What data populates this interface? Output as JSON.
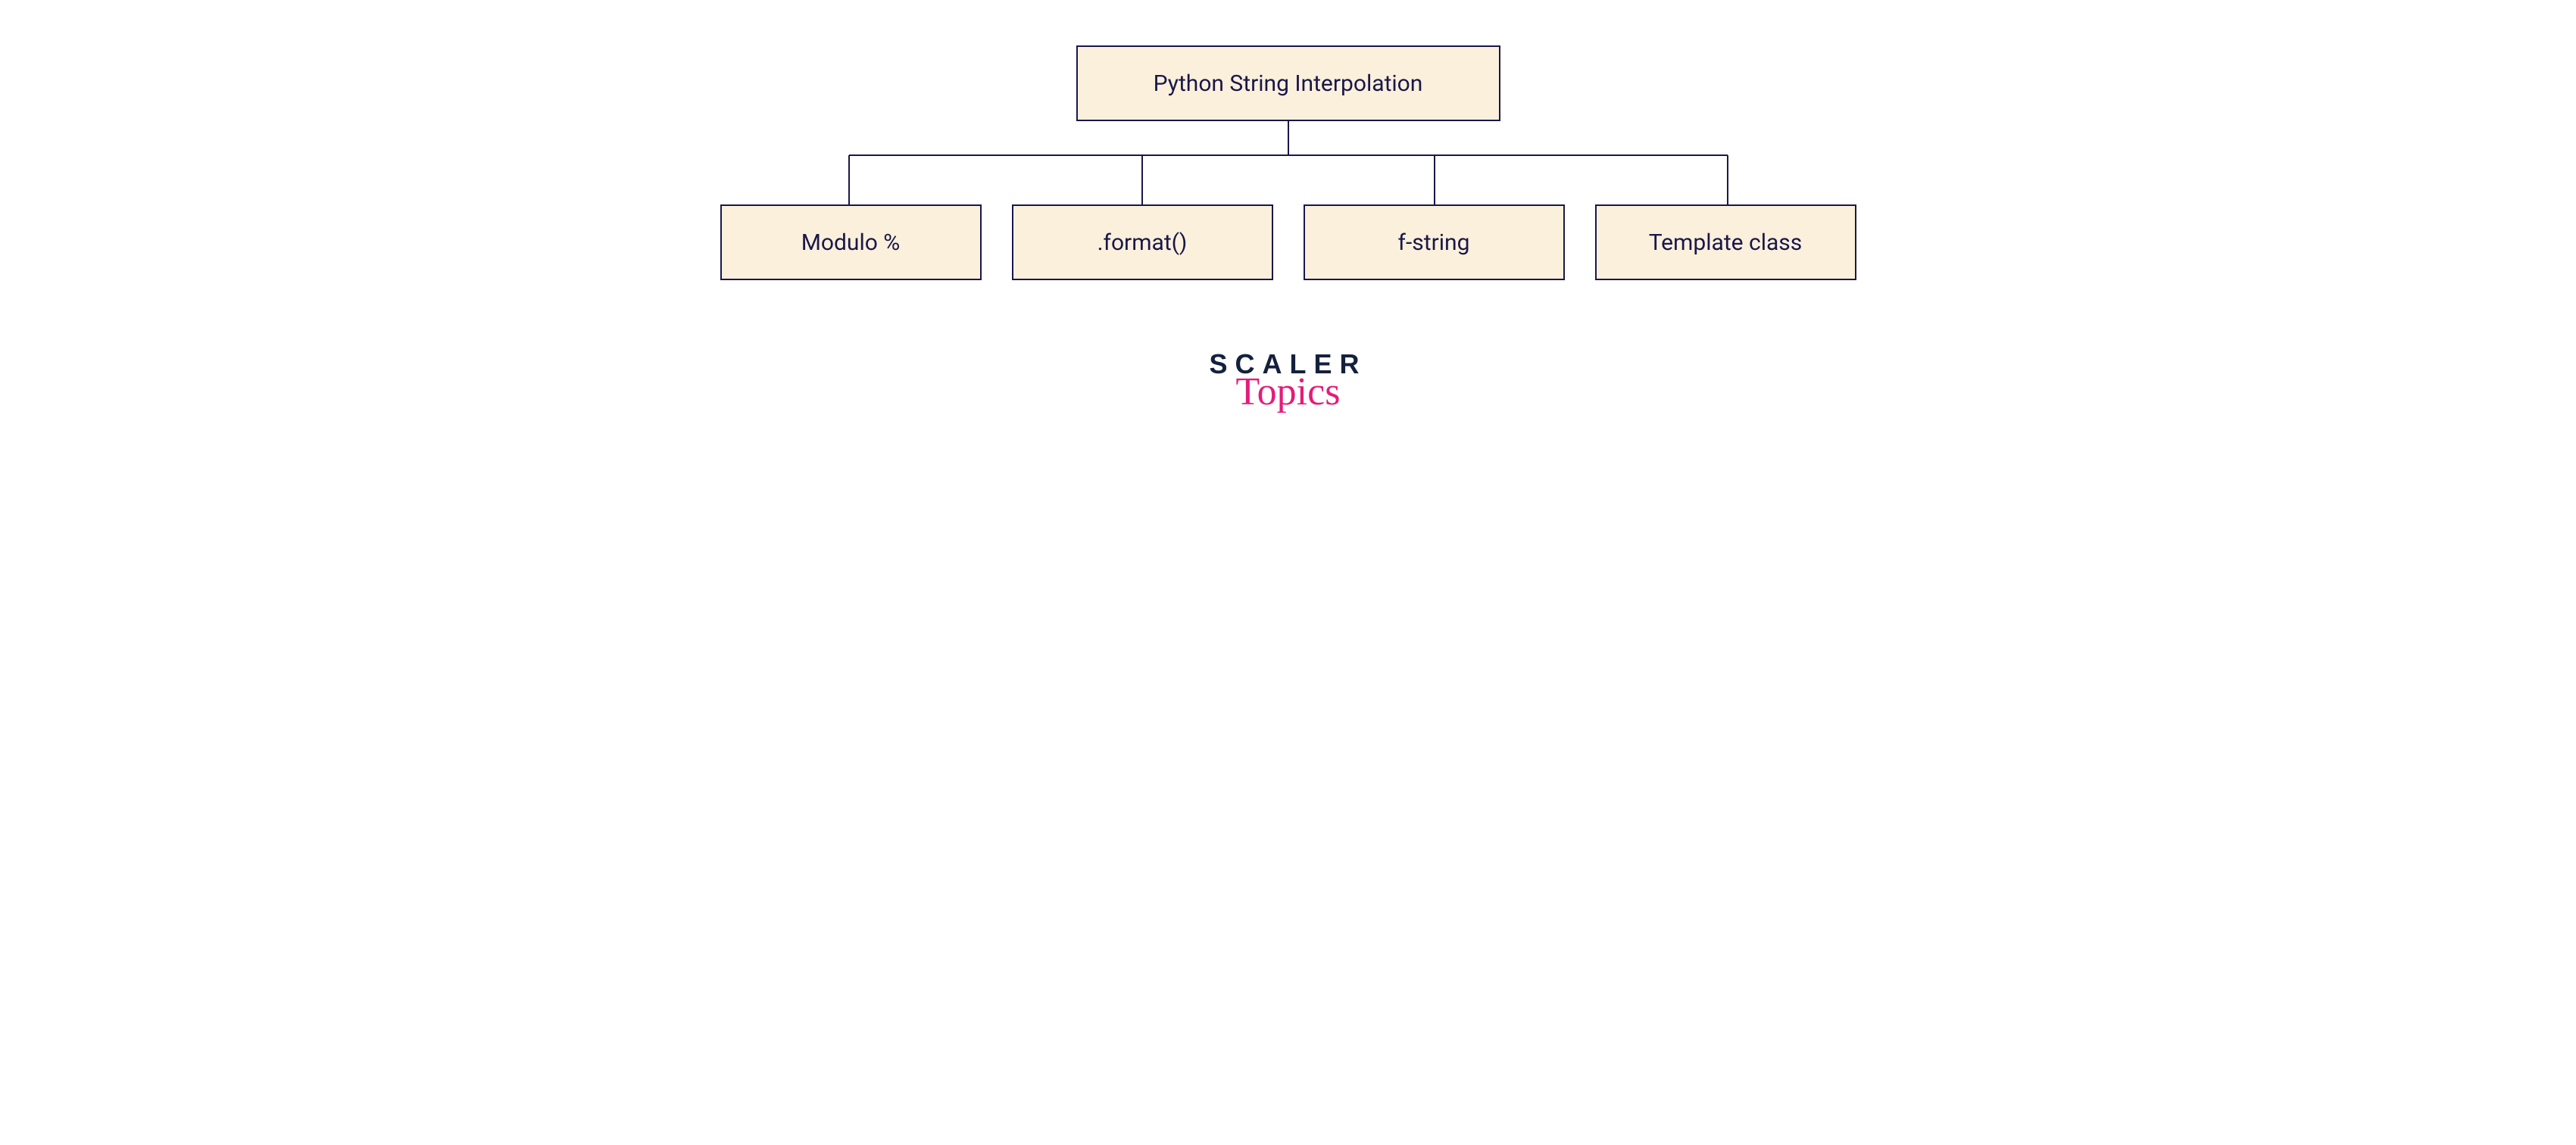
{
  "diagram": {
    "root": {
      "label": "Python String Interpolation"
    },
    "children": [
      {
        "label": "Modulo %"
      },
      {
        "label": ".format()"
      },
      {
        "label": "f-string"
      },
      {
        "label": "Template class"
      }
    ]
  },
  "brand": {
    "line1": "SCALER",
    "line2": "Topics"
  },
  "colors": {
    "node_border": "#1a1749",
    "node_fill": "#faf0dc",
    "brand_dark": "#14213d",
    "brand_pink": "#e31c79"
  }
}
